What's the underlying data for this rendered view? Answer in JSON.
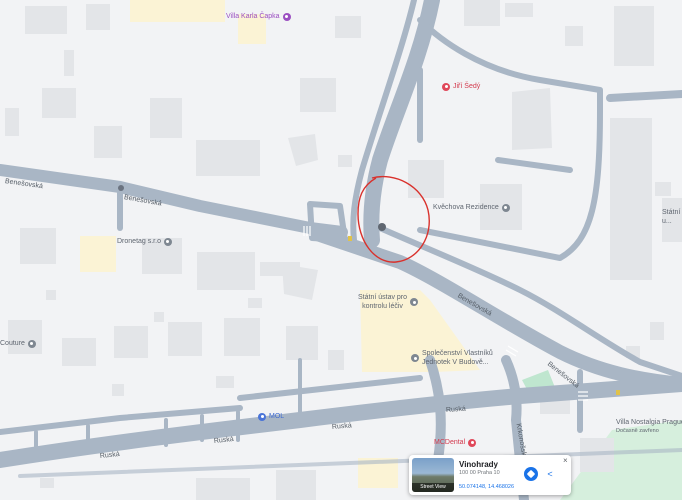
{
  "colors": {
    "background": "#f2f3f5",
    "road": "#a9b6c5",
    "building": "#e3e5e8",
    "park": "#bfe6cf",
    "yellow_block": "#fbf3d5",
    "annotation_circle": "#d9312c"
  },
  "streets": {
    "benesovska_1": "Benešovská",
    "benesovska_2": "Benešovská",
    "benesovska_3": "Benešovská",
    "benesovska_4": "Benešovská",
    "ruska_1": "Ruská",
    "ruska_2": "Ruská",
    "ruska_3": "Ruská",
    "ruska_4": "Ruská",
    "krkonosska": "Krkonošská"
  },
  "pois": {
    "villa_karla_capka": "Villa Karla Čapka",
    "jiri_sedy": "Jiří Šedý",
    "kvechova_rezidence": "Kvěchova Rezidence",
    "dronetag": "Dronetag s.r.o",
    "statni_ustav_line1": "Státní ústav pro",
    "statni_ustav_line2": "kontrolu léčiv",
    "spolecenstvi_line1": "Společenství Vlastníků",
    "spolecenstvi_line2": "Jednotek V Budově...",
    "couture": "Couture",
    "mol": "MOL",
    "mcdental": "MCDental",
    "villa_nostalgia_line1": "Villa Nostalgia Prague",
    "villa_nostalgia_line2": "Dočasně zavřeno",
    "statni_edge": "Státní",
    "statni_edge2": "u..."
  },
  "info_card": {
    "title": "Vinohrady",
    "address": "100 00 Praha 10",
    "coordinates": "50.074148, 14.468026",
    "thumbnail_label": "Street View",
    "close_icon": "×",
    "directions_icon": "directions-icon",
    "share_icon": "share-icon"
  }
}
